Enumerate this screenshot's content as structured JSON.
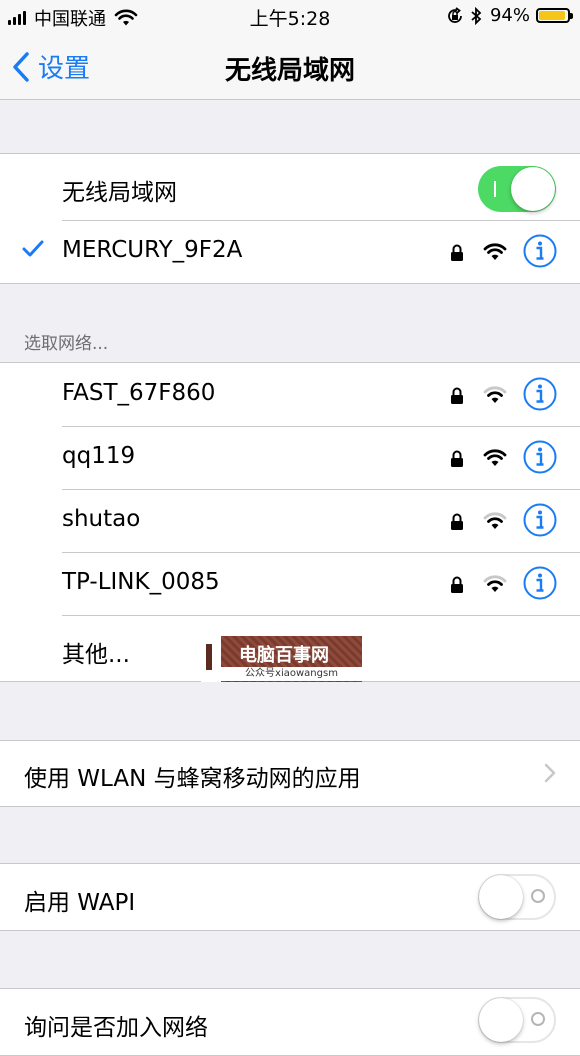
{
  "status_bar": {
    "carrier": "中国联通",
    "time": "上午5:28",
    "battery_percent_text": "94%",
    "battery_level": 0.94,
    "battery_color": "#f5c518"
  },
  "nav": {
    "back_label": "设置",
    "title": "无线局域网",
    "accent_color": "#1a7cf5"
  },
  "wlan_toggle": {
    "label": "无线局域网",
    "on": true
  },
  "connected_network": {
    "name": "MERCURY_9F2A",
    "secured": true,
    "signal": "full",
    "icons": [
      "checkmark-icon",
      "lock-icon",
      "wifi-icon",
      "info-icon"
    ]
  },
  "choose_network_header": "选取网络...",
  "networks": [
    {
      "name": "FAST_67F860",
      "secured": true,
      "signal": "medium"
    },
    {
      "name": "qq119",
      "secured": true,
      "signal": "full"
    },
    {
      "name": "shutao",
      "secured": true,
      "signal": "medium"
    },
    {
      "name": "TP-LINK_0085",
      "secured": true,
      "signal": "medium"
    }
  ],
  "other_label": "其他...",
  "watermark": {
    "title": "电脑百事网",
    "subtitle": "公众号xiaowangsm"
  },
  "wlan_cellular_apps": {
    "label": "使用 WLAN 与蜂窝移动网的应用"
  },
  "wapi": {
    "label": "启用 WAPI",
    "on": false
  },
  "ask_to_join": {
    "label": "询问是否加入网络",
    "on": false
  }
}
